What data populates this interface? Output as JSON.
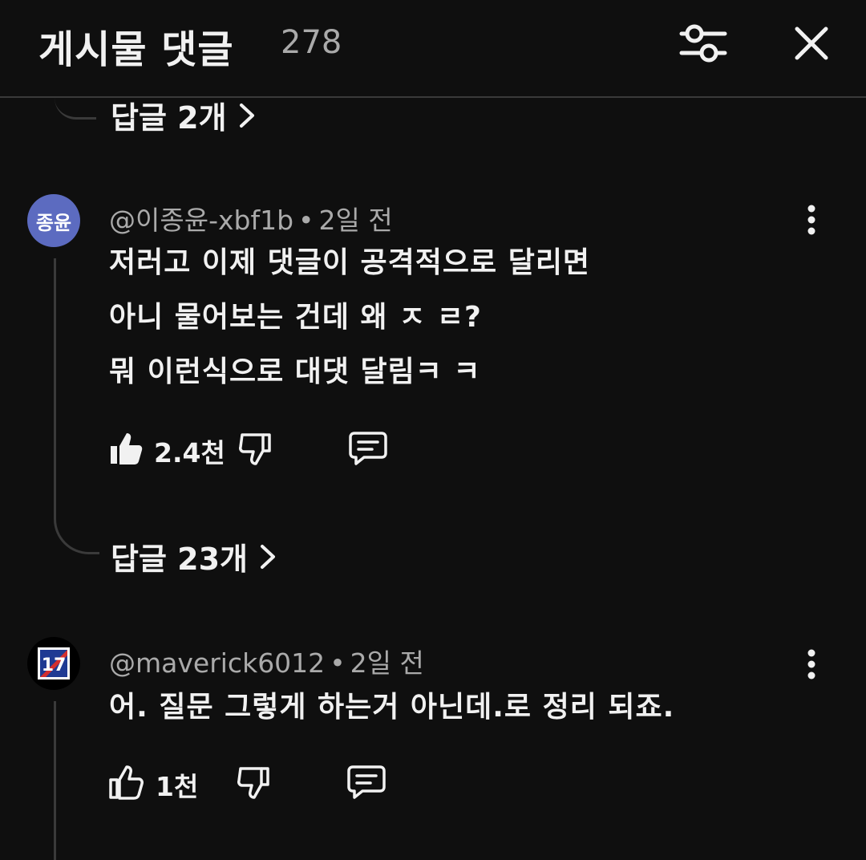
{
  "header": {
    "title": "게시물 댓글",
    "count": "278"
  },
  "prev_thread": {
    "replies_label": "답글 2개"
  },
  "comments": [
    {
      "avatar_text": "종윤",
      "author": "@이종윤-xbf1b",
      "separator": "•",
      "time": "2일 전",
      "lines": [
        "저러고 이제 댓글이 공격적으로 달리면",
        "아니 물어보는 건데 왜 ㅈ ㄹ?",
        "뭐 이런식으로 대댓 달림ㅋ ㅋ"
      ],
      "likes": "2.4천",
      "liked": true,
      "replies_label": "답글 23개"
    },
    {
      "avatar_text": "17",
      "author": "@maverick6012",
      "separator": "•",
      "time": "2일 전",
      "lines": [
        "어. 질문 그렇게 하는거 아닌데.로 정리 되죠."
      ],
      "likes": "1천",
      "liked": false
    }
  ],
  "icons": {
    "filter": "filter-sliders-icon",
    "close": "close-icon",
    "more": "more-vert-icon",
    "like": "thumb-up-icon",
    "dislike": "thumb-down-icon",
    "reply": "reply-comment-icon",
    "chevron": "chevron-right-icon"
  },
  "colors": {
    "background": "#0f0f0f",
    "text": "#f1f1f1",
    "secondary_text": "#aaaaaa",
    "avatar_1": "#5c6bc0"
  }
}
